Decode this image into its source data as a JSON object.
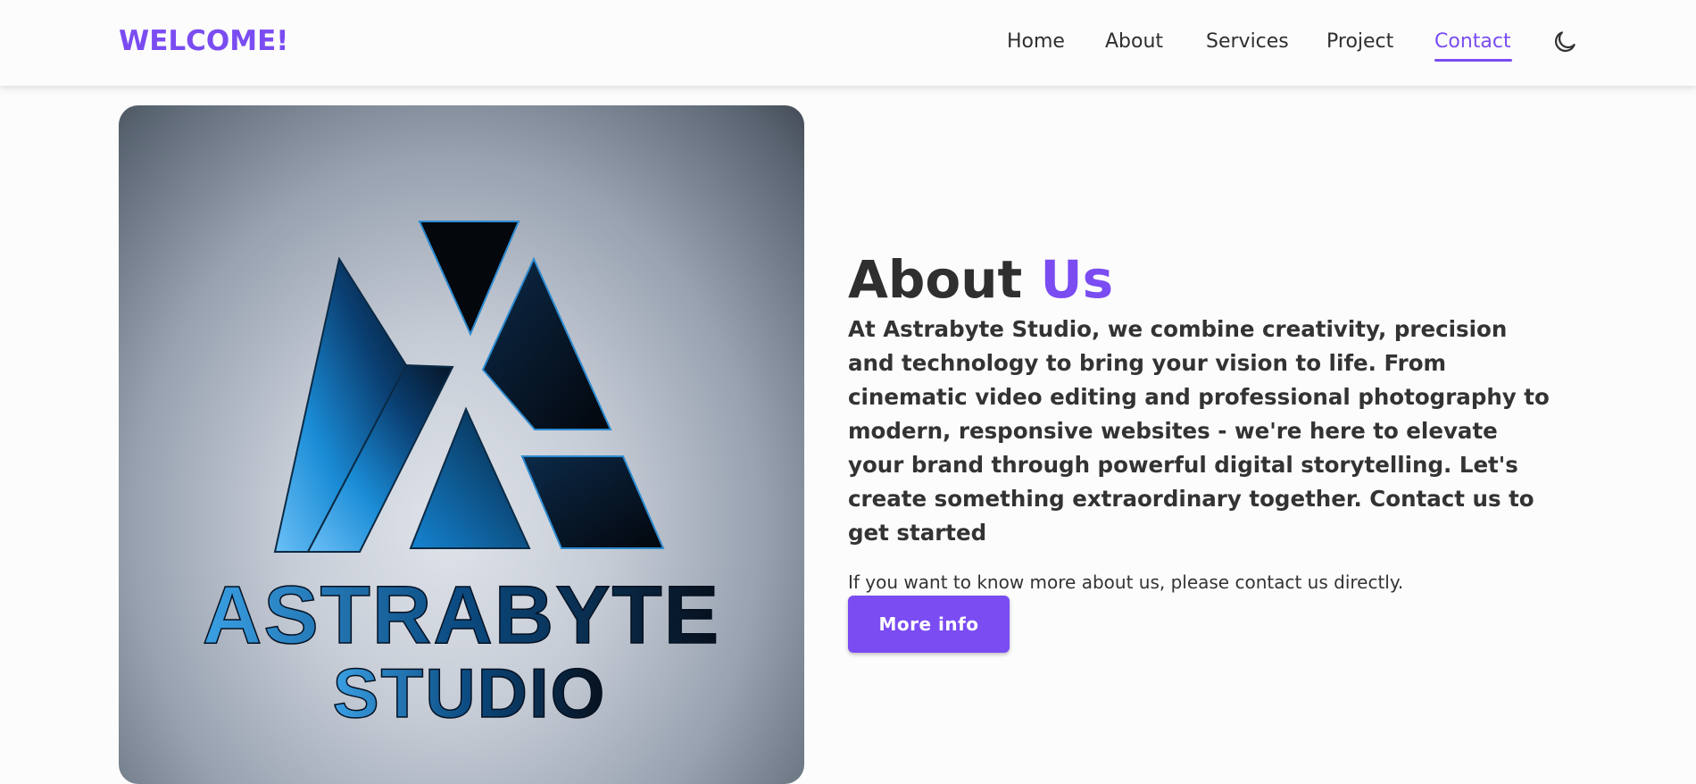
{
  "nav": {
    "brand": "WELCOME!",
    "links": [
      {
        "label": "Home",
        "active": false
      },
      {
        "label": "About",
        "active": false
      },
      {
        "label": "Services",
        "active": false
      },
      {
        "label": "Project",
        "active": false
      },
      {
        "label": "Contact",
        "active": true
      }
    ],
    "theme_toggle_icon": "moon-icon"
  },
  "hero": {
    "logo_line1": "ASTRABYTE",
    "logo_line2": "STUDIO"
  },
  "about": {
    "title_main": "About",
    "title_accent": "Us",
    "lead": "At Astrabyte Studio, we combine creativity, precision and technology to bring your vision to life. From cinematic video editing and professional photography to modern, responsive websites - we're here to elevate your brand through powerful digital storytelling. Let's create something extraordinary together. Contact us to get started",
    "sub": "If you want to know more about us, please contact us directly.",
    "button_label": "More info"
  },
  "colors": {
    "accent": "#7a4cf1",
    "text": "#2f2f2f",
    "background": "#fcfcfc"
  }
}
